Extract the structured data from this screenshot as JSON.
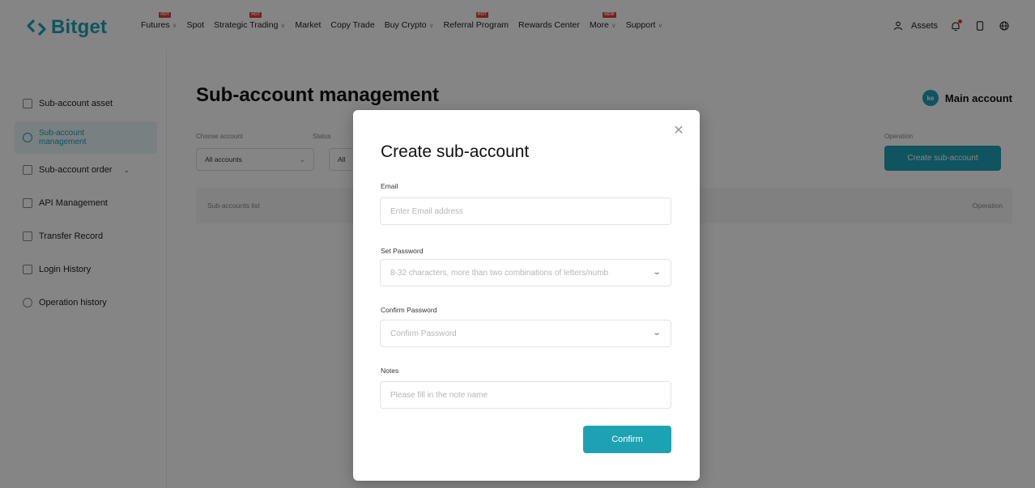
{
  "brand": {
    "name": "Bitget",
    "accent": "#1da2b4",
    "badge_color": "#e03e3e"
  },
  "topnav": {
    "items": [
      {
        "label": "Futures",
        "badge": "HOT",
        "dropdown": true
      },
      {
        "label": "Spot",
        "badge": "",
        "dropdown": false
      },
      {
        "label": "Strategic Trading",
        "badge": "HOT",
        "dropdown": true
      },
      {
        "label": "Market",
        "badge": "",
        "dropdown": false
      },
      {
        "label": "Copy Trade",
        "badge": "",
        "dropdown": false
      },
      {
        "label": "Buy Crypto",
        "badge": "",
        "dropdown": true
      },
      {
        "label": "Referral Program",
        "badge": "HOT",
        "dropdown": false
      },
      {
        "label": "Rewards Center",
        "badge": "",
        "dropdown": false
      },
      {
        "label": "More",
        "badge": "NEW",
        "dropdown": true
      },
      {
        "label": "Support",
        "badge": "",
        "dropdown": true
      }
    ],
    "right": {
      "assets_label": "Assets",
      "icons": [
        "user-icon",
        "bell-icon",
        "phone-icon",
        "globe-icon"
      ]
    }
  },
  "sidebar": {
    "items": [
      {
        "label": "Sub-account asset",
        "active": false
      },
      {
        "label": "Sub-account management",
        "active": true
      },
      {
        "label": "Sub-account order",
        "active": false,
        "expandable": true
      },
      {
        "label": "API Management",
        "active": false
      },
      {
        "label": "Transfer Record",
        "active": false
      },
      {
        "label": "Login History",
        "active": false
      },
      {
        "label": "Operation history",
        "active": false
      }
    ]
  },
  "main": {
    "title": "Sub-account management",
    "main_account_label": "Main account",
    "avatar_initials": "ke",
    "filters": {
      "account_label": "Choose account",
      "account_value": "All accounts",
      "status_label": "Status",
      "status_value": "All",
      "operation_label": "Operation"
    },
    "create_button": "Create sub-account",
    "table": {
      "col_list": "Sub-accounts list",
      "col_operation": "Operation"
    }
  },
  "modal": {
    "title": "Create sub-account",
    "close_icon": "close-icon",
    "email": {
      "label": "Email",
      "placeholder": "Enter Email address"
    },
    "password": {
      "label": "Set Password",
      "placeholder": "8-32 characters, more than two combinations of letters/numb"
    },
    "confirm_password": {
      "label": "Confirm Password",
      "placeholder": "Confirm Password"
    },
    "notes": {
      "label": "Notes",
      "placeholder": "Please fill in the note name"
    },
    "confirm_button": "Confirm"
  }
}
